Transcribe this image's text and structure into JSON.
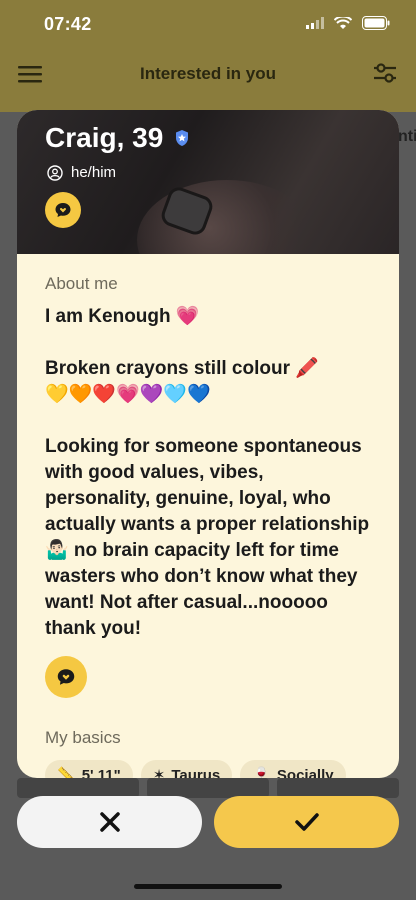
{
  "status_bar": {
    "time": "07:42"
  },
  "header": {
    "title": "Interested in you",
    "side_peek": "nti"
  },
  "profile": {
    "name": "Craig, 39",
    "pronouns": "he/him",
    "about_label": "About me",
    "bio": "I am Kenough 💗\n\nBroken crayons still colour 🖍️\n💛🧡❤️💗💜🩵💙\n\nLooking for someone spontaneous with good values, vibes, personality, genuine, loyal, who actually wants a proper relationship 🤷🏻‍♂️ no brain capacity left for time wasters who don’t know what they want! Not after casual...nooooo thank you!",
    "basics_label": "My basics",
    "basics": [
      {
        "icon": "ruler-icon",
        "label": "5' 11\""
      },
      {
        "icon": "zodiac-icon",
        "label": "Taurus"
      },
      {
        "icon": "drink-icon",
        "label": "Socially"
      }
    ]
  },
  "colors": {
    "accent_yellow": "#f5c842",
    "card_bg": "#fdf6dc"
  }
}
